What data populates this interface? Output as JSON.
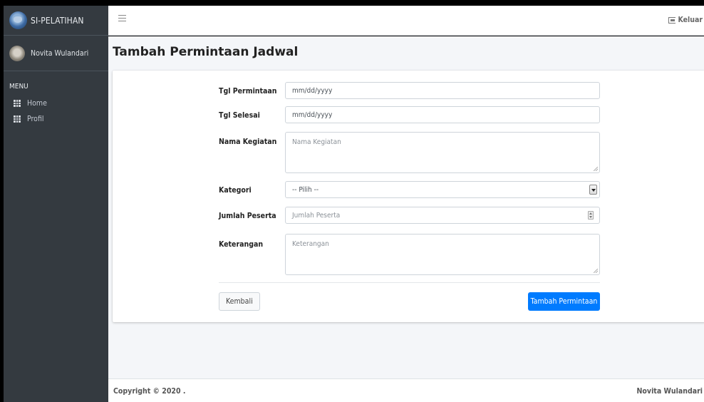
{
  "sidebar": {
    "brand": "SI-PELATIHAN",
    "user_name": "Novita Wulandari",
    "menu_header": "MENU",
    "items": [
      {
        "label": "Home",
        "icon": "grid-icon"
      },
      {
        "label": "Profil",
        "icon": "grid-icon"
      }
    ]
  },
  "header": {
    "menu_icon": "hamburger-icon",
    "logout_label": "Keluar",
    "logout_icon": "sign-out-icon"
  },
  "page": {
    "title": "Tambah Permintaan Jadwal"
  },
  "form": {
    "tgl_permintaan": {
      "label": "Tgl Permintaan",
      "value": "mm/dd/yyyy"
    },
    "tgl_selesai": {
      "label": "Tgl Selesai",
      "value": "mm/dd/yyyy"
    },
    "nama_kegiatan": {
      "label": "Nama Kegiatan",
      "placeholder": "Nama Kegiatan"
    },
    "kategori": {
      "label": "Kategori",
      "selected": "-- Pilih --"
    },
    "jumlah_peserta": {
      "label": "Jumlah Peserta",
      "placeholder": "Jumlah Peserta"
    },
    "keterangan": {
      "label": "Keterangan",
      "placeholder": "Keterangan"
    },
    "back_label": "Kembali",
    "submit_label": "Tambah Permintaan"
  },
  "footer": {
    "copyright": "Copyright © 2020 .",
    "author": "Novita Wulandari"
  },
  "colors": {
    "sidebar_bg": "#343a40",
    "content_bg": "#f4f6f9",
    "primary": "#007bff"
  }
}
